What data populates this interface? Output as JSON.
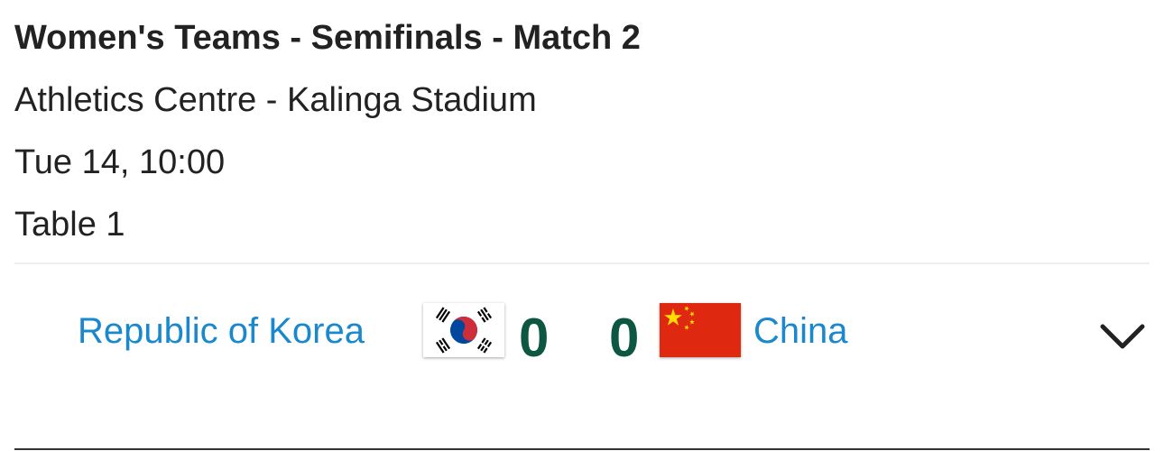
{
  "match": {
    "title": "Women's Teams - Semifinals - Match 2",
    "venue": "Athletics Centre - Kalinga Stadium",
    "datetime": "Tue 14, 10:00",
    "table": "Table 1"
  },
  "home": {
    "name": "Republic of Korea",
    "score": "0",
    "flag": "korea-flag"
  },
  "away": {
    "name": "China",
    "score": "0",
    "flag": "china-flag"
  },
  "colors": {
    "team_link": "#1a88cc",
    "score": "#0d5641",
    "china_red": "#de2910",
    "china_star": "#ffde00",
    "korea_red": "#cd2e3a",
    "korea_blue": "#0047a0"
  },
  "icons": {
    "expand": "chevron-down-icon"
  }
}
